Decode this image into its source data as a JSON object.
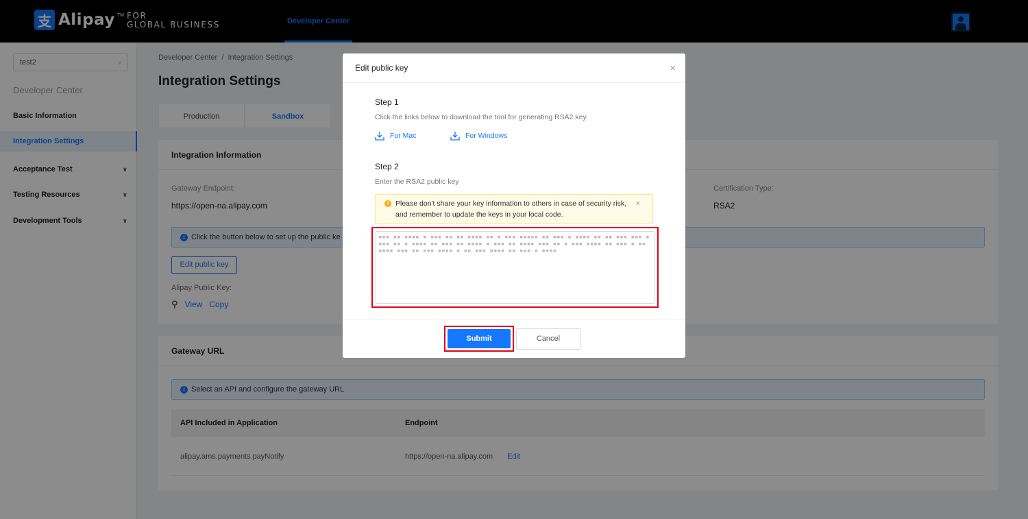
{
  "brand": {
    "logo_glyph": "支",
    "name": "Alipay",
    "tm": "TM",
    "sub1": "FOR",
    "sub2": "GLOBAL BUSINESS"
  },
  "topnav": {
    "developer_center": "Developer Center"
  },
  "sidebar": {
    "app_select_value": "test2",
    "title": "Developer Center",
    "items": [
      {
        "label": "Basic Information"
      },
      {
        "label": "Integration Settings"
      },
      {
        "label": "Acceptance Test"
      },
      {
        "label": "Testing Resources"
      },
      {
        "label": "Development Tools"
      }
    ]
  },
  "main": {
    "breadcrumb": "Developer Center  /  Integration Settings",
    "page_title": "Integration Settings",
    "tabs": [
      {
        "label": "Production"
      },
      {
        "label": "Sandbox"
      }
    ],
    "integration": {
      "title": "Integration Information",
      "gateway_label": "Gateway Endpoint:",
      "gateway_value": "https://open-na.alipay.com",
      "cert_label": "Certification Type:",
      "cert_value": "RSA2",
      "info_text": "Click the button below to set up the public ke",
      "edit_button": "Edit public key",
      "alipay_key_label": "Alipay Public Key:",
      "view_link": "View",
      "copy_link": "Copy"
    },
    "gateway_url": {
      "title": "Gateway URL",
      "info_text": "Select an API and configure the gateway URL",
      "col_api": "API Included in Application",
      "col_endpoint": "Endpoint",
      "rows": [
        {
          "api": "alipay.ams.payments.payNotify",
          "endpoint": "https://open-na.alipay.com",
          "action": "Edit"
        }
      ]
    }
  },
  "modal": {
    "title": "Edit public key",
    "close_glyph": "×",
    "step1_title": "Step 1",
    "step1_hint": "Click the links below to download the tool for generating RSA2 key.",
    "for_mac": "For Mac",
    "for_windows": "For Windows",
    "step2_title": "Step 2",
    "step2_hint": "Enter the RSA2 public key",
    "warning_line1": "Please don't share your key information to others in case of security risk,",
    "warning_line2": "and remember to update the keys in your local code.",
    "key_value": "▪▪▪ ▪▪ ▪▪▪▪ ▪ ▪▪▪ ▪▪ ▪▪ ▪▪▪▪ ▪▪ ▪ ▪▪▪ ▪▪▪▪▪ ▪▪ ▪▪▪ ▪ ▪▪▪▪ ▪▪ ▪▪ ▪▪▪ ▪▪▪ ▪▪▪▪ ▪▪ ▪ ▪▪▪▪ ▪▪ ▪▪▪ ▪▪ ▪▪▪▪ ▪ ▪▪▪ ▪▪ ▪▪▪▪ ▪▪▪ ▪▪ ▪ ▪▪▪ ▪▪▪▪ ▪▪ ▪▪▪ ▪ ▪▪ ▪▪▪▪ ▪▪▪ ▪▪ ▪▪▪ ▪▪▪▪ ▪ ▪▪ ▪▪▪ ▪▪▪▪ ▪▪ ▪▪▪ ▪ ▪▪▪▪",
    "submit": "Submit",
    "cancel": "Cancel"
  },
  "colors": {
    "primary": "#1677ff",
    "highlight_box": "#e60012",
    "topbar": "#000000"
  }
}
